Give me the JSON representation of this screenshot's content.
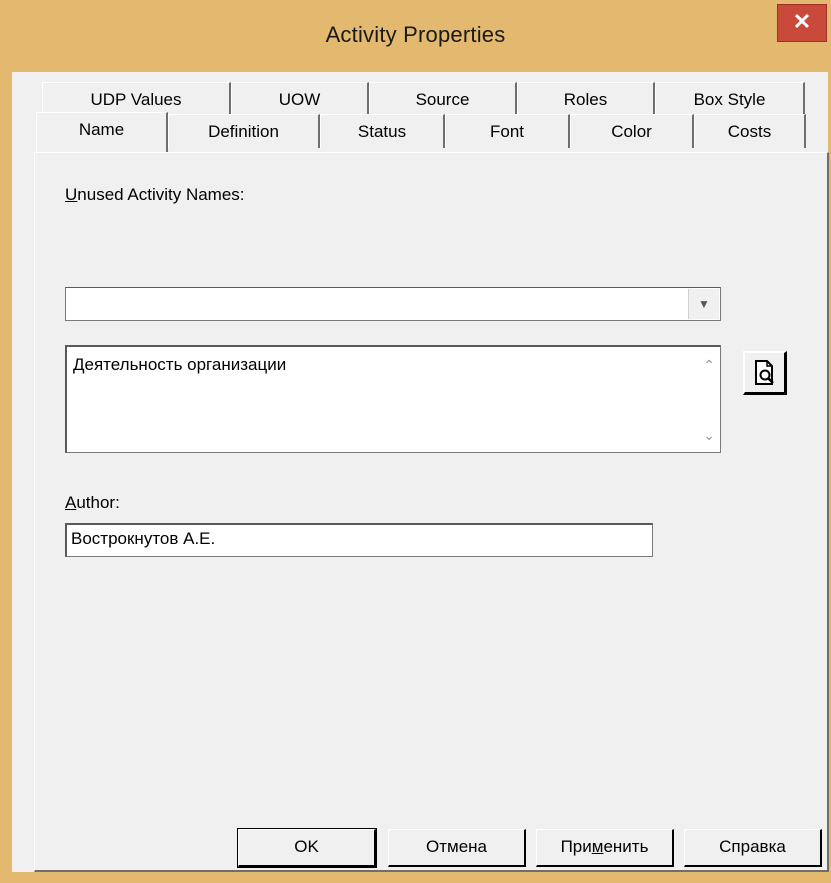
{
  "window": {
    "title": "Activity Properties",
    "close_glyph": "✕"
  },
  "tabs": {
    "row1": [
      "UDP Values",
      "UOW",
      "Source",
      "Roles",
      "Box Style"
    ],
    "row2": [
      "Name",
      "Definition",
      "Status",
      "Font",
      "Color",
      "Costs"
    ],
    "active": "Name"
  },
  "name_tab": {
    "unused_label_mnemonic": "U",
    "unused_label_rest": "nused Activity Names:",
    "unused_value": "",
    "activity_name": "Деятельность организации",
    "author_label_mnemonic": "A",
    "author_label_rest": "uthor:",
    "author_value": "Востроknутов А.Е."
  },
  "buttons": {
    "ok": "OK",
    "cancel": "Отмена",
    "apply_pre": "При",
    "apply_mnemonic": "м",
    "apply_post": "енить",
    "help": "Справка"
  },
  "icons": {
    "combo_arrow": "dropdown-arrow-icon",
    "browse": "document-magnifier-icon",
    "scroll_up": "chevron-up-icon",
    "scroll_down": "chevron-down-icon"
  }
}
